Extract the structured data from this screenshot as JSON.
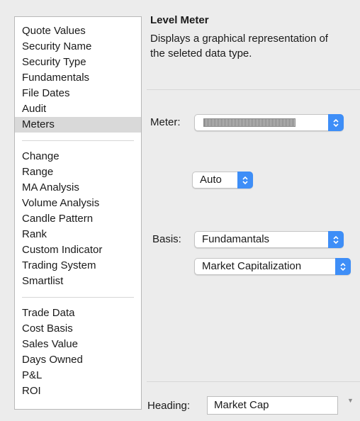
{
  "sidebar": {
    "groups": [
      [
        "Quote Values",
        "Security Name",
        "Security Type",
        "Fundamentals",
        "File Dates",
        "Audit",
        "Meters"
      ],
      [
        "Change",
        "Range",
        "MA Analysis",
        "Volume Analysis",
        "Candle Pattern",
        "Rank",
        "Custom Indicator",
        "Trading System",
        "Smartlist"
      ],
      [
        "Trade Data",
        "Cost Basis",
        "Sales Value",
        "Days Owned",
        "P&L",
        "ROI"
      ]
    ],
    "selected": "Meters"
  },
  "panel": {
    "title": "Level Meter",
    "description": "Displays a graphical representation of the seleted data type."
  },
  "meter": {
    "label": "Meter:"
  },
  "auto": {
    "value": "Auto"
  },
  "basis": {
    "label": "Basis:",
    "value": "Fundamantals",
    "subvalue": "Market Capitalization"
  },
  "heading": {
    "label": "Heading:",
    "value": "Market Cap"
  },
  "colors": {
    "accent": "#3e8ef7",
    "selection": "#d9d9d9"
  }
}
